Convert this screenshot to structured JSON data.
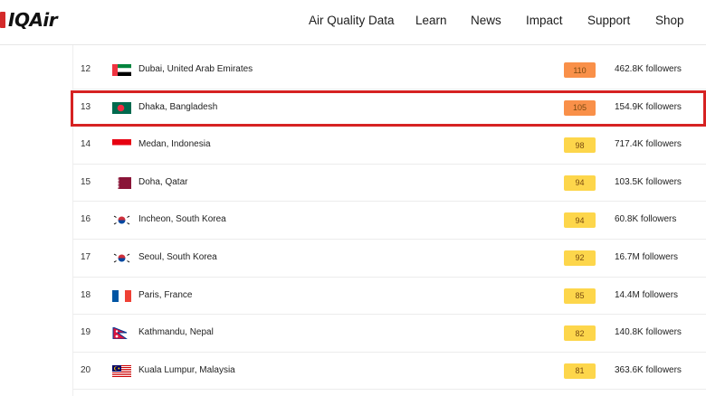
{
  "header": {
    "logo_text": "IQAir",
    "nav": [
      "Air Quality Data",
      "Learn",
      "News",
      "Impact",
      "Support",
      "Shop"
    ]
  },
  "colors": {
    "orange_aqi": "#f99049",
    "yellow_aqi": "#fdd64b",
    "highlight_border": "#d62222"
  },
  "rows": [
    {
      "rank": "12",
      "city": "Dubai, United Arab Emirates",
      "aqi": "110",
      "aqi_level": "orange",
      "followers": "462.8K followers",
      "flag": "uae-flag-icon"
    },
    {
      "rank": "13",
      "city": "Dhaka, Bangladesh",
      "aqi": "105",
      "aqi_level": "orange",
      "followers": "154.9K followers",
      "flag": "bangladesh-flag-icon",
      "highlighted": true
    },
    {
      "rank": "14",
      "city": "Medan, Indonesia",
      "aqi": "98",
      "aqi_level": "yellow",
      "followers": "717.4K followers",
      "flag": "indonesia-flag-icon"
    },
    {
      "rank": "15",
      "city": "Doha, Qatar",
      "aqi": "94",
      "aqi_level": "yellow",
      "followers": "103.5K followers",
      "flag": "qatar-flag-icon"
    },
    {
      "rank": "16",
      "city": "Incheon, South Korea",
      "aqi": "94",
      "aqi_level": "yellow",
      "followers": "60.8K followers",
      "flag": "south-korea-flag-icon"
    },
    {
      "rank": "17",
      "city": "Seoul, South Korea",
      "aqi": "92",
      "aqi_level": "yellow",
      "followers": "16.7M followers",
      "flag": "south-korea-flag-icon"
    },
    {
      "rank": "18",
      "city": "Paris, France",
      "aqi": "85",
      "aqi_level": "yellow",
      "followers": "14.4M followers",
      "flag": "france-flag-icon"
    },
    {
      "rank": "19",
      "city": "Kathmandu, Nepal",
      "aqi": "82",
      "aqi_level": "yellow",
      "followers": "140.8K followers",
      "flag": "nepal-flag-icon"
    },
    {
      "rank": "20",
      "city": "Kuala Lumpur, Malaysia",
      "aqi": "81",
      "aqi_level": "yellow",
      "followers": "363.6K followers",
      "flag": "malaysia-flag-icon"
    }
  ]
}
